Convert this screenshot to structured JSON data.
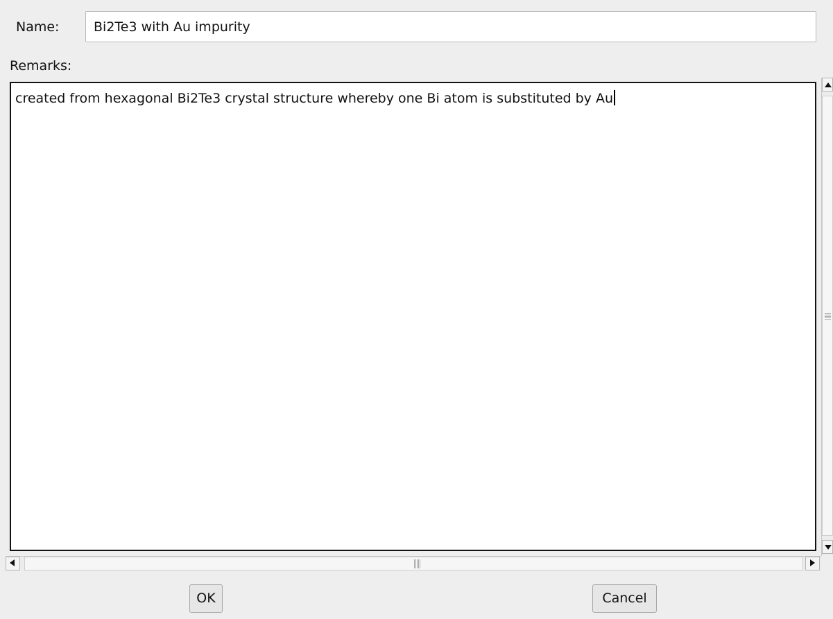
{
  "dialog": {
    "name_label": "Name:",
    "name_value": "Bi2Te3 with Au impurity",
    "remarks_label": "Remarks:",
    "remarks_value": "created from hexagonal Bi2Te3 crystal structure whereby one Bi atom is substituted by Au",
    "ok_label": "OK",
    "cancel_label": "Cancel"
  }
}
